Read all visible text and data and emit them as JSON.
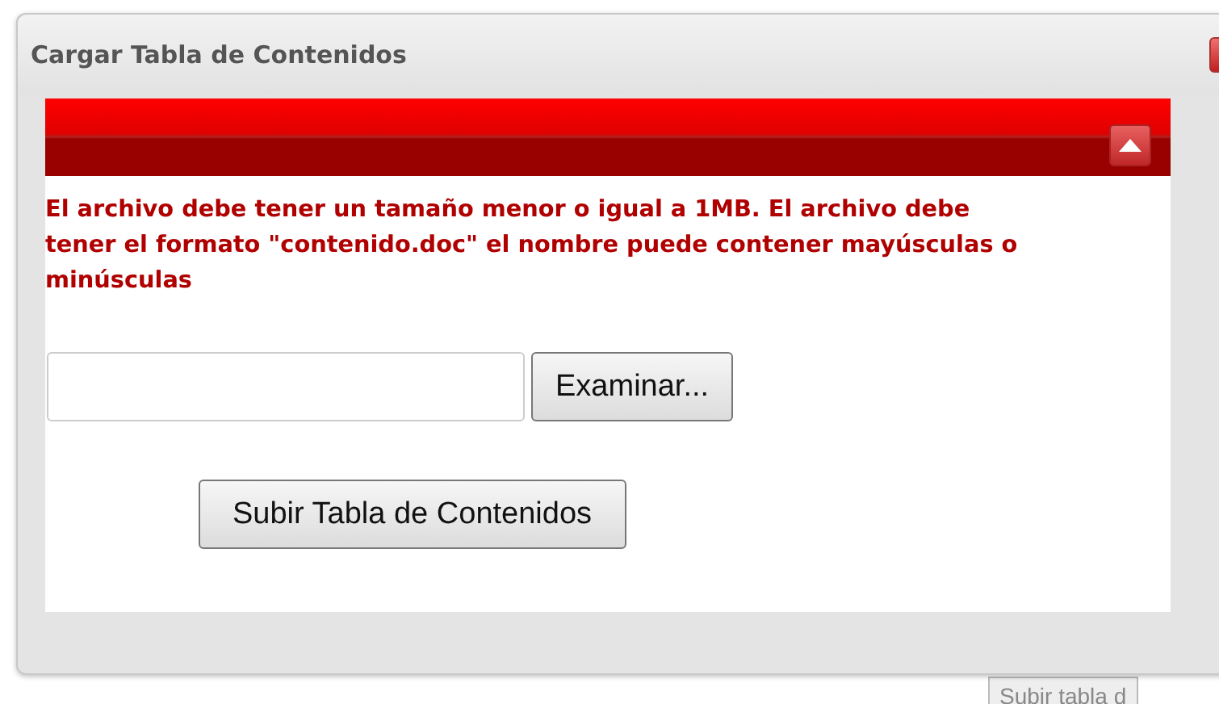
{
  "dialog": {
    "title": "Cargar Tabla de Contenidos",
    "banner": {
      "expanded": true
    },
    "message": "El archivo debe tener un tamaño menor o igual a 1MB. El archivo debe tener el formato \"contenido.doc\" el nombre puede contener mayúsculas o minúsculas",
    "browse_button": "Examinar...",
    "upload_button": "Subir Tabla de Contenidos"
  },
  "background": {
    "button": "Subir tabla d"
  }
}
